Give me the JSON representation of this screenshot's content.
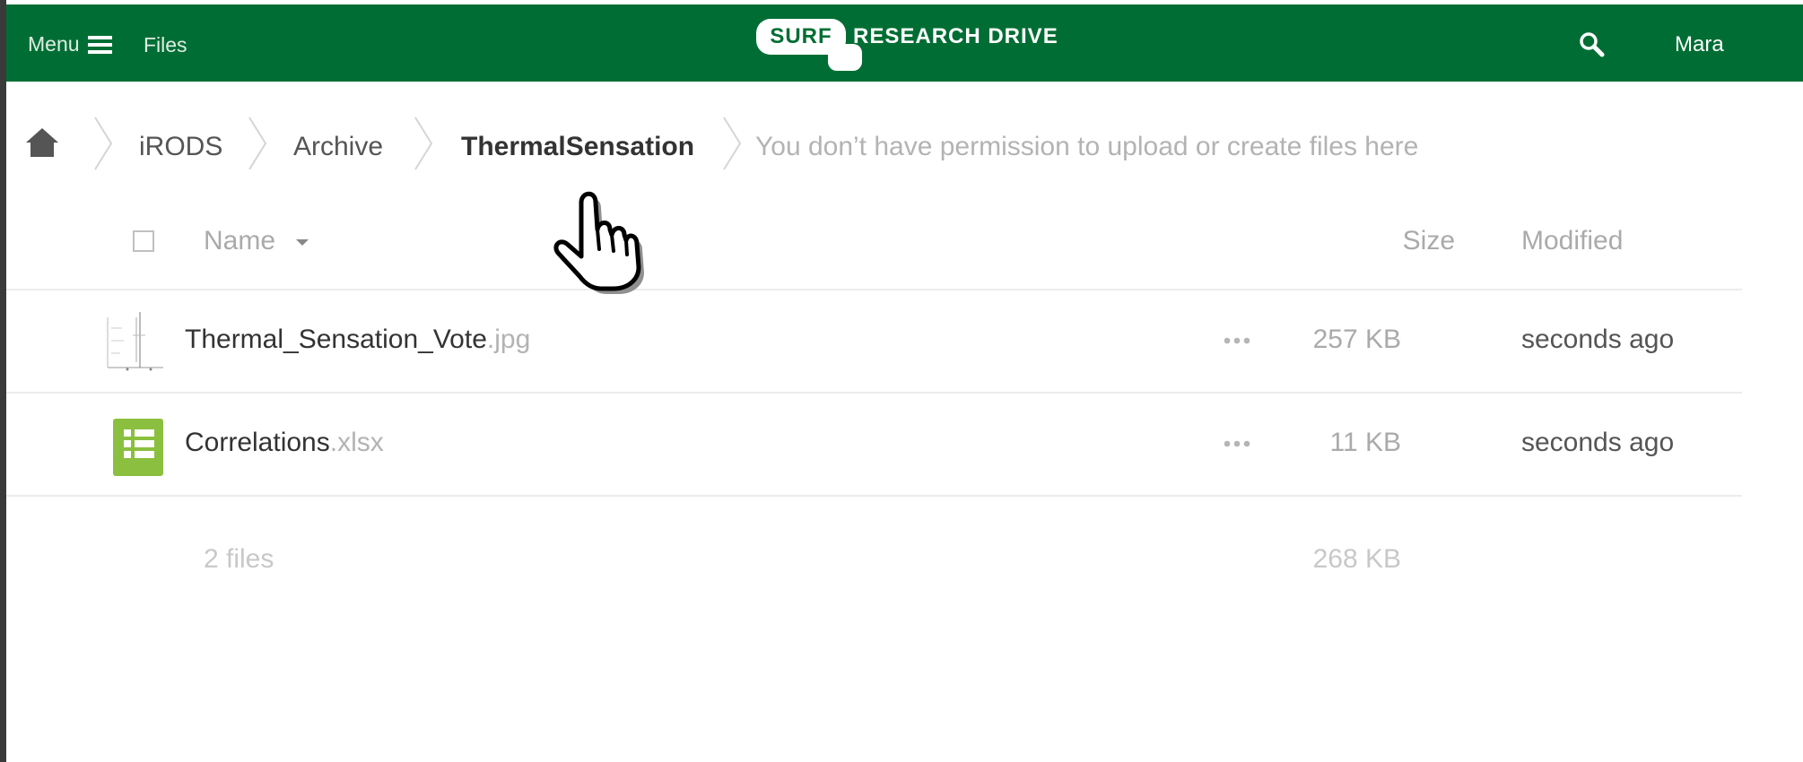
{
  "header": {
    "menu_label": "Menu",
    "files_label": "Files",
    "logo_badge": "SURF",
    "logo_text": "RESEARCH DRIVE",
    "user_name": "Mara",
    "colors": {
      "bar": "#006e34",
      "text": "#ffffff"
    }
  },
  "breadcrumb": {
    "home_icon": "home-icon",
    "items": [
      {
        "label": "iRODS"
      },
      {
        "label": "Archive"
      },
      {
        "label": "ThermalSensation",
        "current": true
      }
    ],
    "notice": "You don’t have permission to upload or create files here"
  },
  "table": {
    "columns": {
      "name": "Name",
      "size": "Size",
      "modified": "Modified"
    },
    "rows": [
      {
        "name": "Thermal_Sensation_Vote",
        "ext": ".jpg",
        "size": "257 KB",
        "modified": "seconds ago",
        "icon": "image-thumbnail"
      },
      {
        "name": "Correlations",
        "ext": ".xlsx",
        "size": "11 KB",
        "modified": "seconds ago",
        "icon": "spreadsheet-icon"
      }
    ],
    "summary": {
      "count": "2 files",
      "size": "268 KB"
    }
  }
}
